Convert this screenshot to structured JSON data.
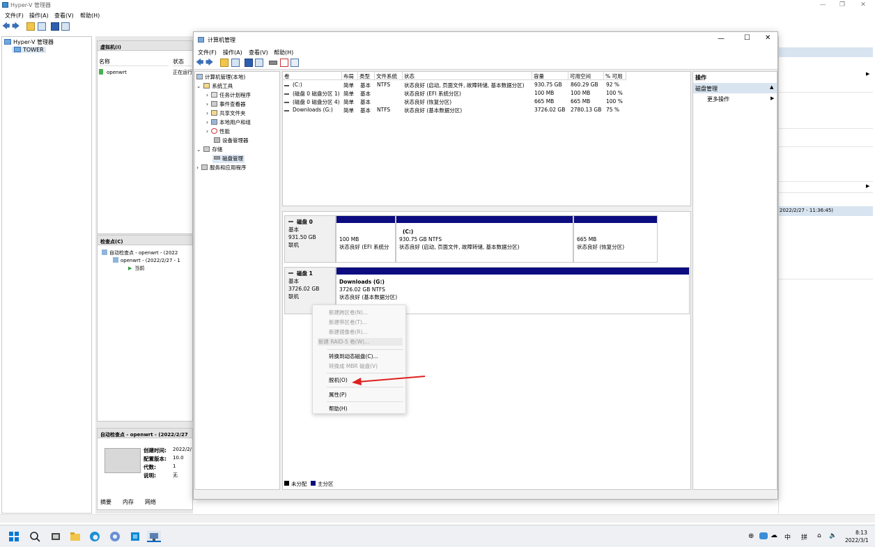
{
  "hyperv": {
    "title": "Hyper-V 管理器",
    "menu": [
      "文件(F)",
      "操作(A)",
      "查看(V)",
      "帮助(H)"
    ],
    "tree_root": "Hyper-V 管理器",
    "tree_host": "TOWER",
    "vm_pane_title": "虚拟机(I)",
    "vm_col_name": "名称",
    "vm_col_state": "状态",
    "vm_name": "openwrt",
    "vm_state": "正在运行",
    "checkpoints_title": "检查点(C)",
    "checkpoint_1": "自动检查点 - openwrt - (2022",
    "checkpoint_2": "openwrt - (2022/2/27 - 1",
    "checkpoint_now": "当前",
    "detail_title": "自动检查点 - openwrt - (2022/2/27",
    "detail_created_label": "创建时间:",
    "detail_created_value": "2022/2/",
    "detail_config_label": "配置版本:",
    "detail_config_value": "10.0",
    "detail_gen_label": "代数:",
    "detail_gen_value": "1",
    "detail_note_label": "说明:",
    "detail_note_value": "无",
    "tabs": [
      "摘要",
      "内存",
      "网络"
    ],
    "right_checkpoint": "2022/2/27 - 11:36:45)"
  },
  "cm": {
    "title": "计算机管理",
    "menu": [
      "文件(F)",
      "操作(A)",
      "查看(V)",
      "帮助(H)"
    ],
    "tree": {
      "root": "计算机管理(本地)",
      "system_tools": "系统工具",
      "task_scheduler": "任务计划程序",
      "event_viewer": "事件查看器",
      "shared_folders": "共享文件夹",
      "local_users": "本地用户和组",
      "performance": "性能",
      "device_manager": "设备管理器",
      "storage": "存储",
      "disk_management": "磁盘管理",
      "services": "服务和应用程序"
    },
    "columns": [
      "卷",
      "布局",
      "类型",
      "文件系统",
      "状态",
      "容量",
      "可用空间",
      "% 可用"
    ],
    "volumes": [
      {
        "name": "(C:)",
        "layout": "简单",
        "type": "基本",
        "fs": "NTFS",
        "status": "状态良好 (启动, 页面文件, 故障转储, 基本数据分区)",
        "capacity": "930.75 GB",
        "free": "860.29 GB",
        "pct": "92 %"
      },
      {
        "name": "(磁盘 0 磁盘分区 1)",
        "layout": "简单",
        "type": "基本",
        "fs": "",
        "status": "状态良好 (EFI 系统分区)",
        "capacity": "100 MB",
        "free": "100 MB",
        "pct": "100 %"
      },
      {
        "name": "(磁盘 0 磁盘分区 4)",
        "layout": "简单",
        "type": "基本",
        "fs": "",
        "status": "状态良好 (恢复分区)",
        "capacity": "665 MB",
        "free": "665 MB",
        "pct": "100 %"
      },
      {
        "name": "Downloads (G:)",
        "layout": "简单",
        "type": "基本",
        "fs": "NTFS",
        "status": "状态良好 (基本数据分区)",
        "capacity": "3726.02 GB",
        "free": "2780.13 GB",
        "pct": "75 %"
      }
    ],
    "disk0": {
      "name": "磁盘 0",
      "type": "基本",
      "size": "931.50 GB",
      "state": "联机"
    },
    "disk0_parts": [
      {
        "title": "",
        "size": "100 MB",
        "status": "状态良好 (EFI 系统分"
      },
      {
        "title": "(C:)",
        "size": "930.75 GB NTFS",
        "status": "状态良好 (启动, 页面文件, 故障转储, 基本数据分区)"
      },
      {
        "title": "",
        "size": "665 MB",
        "status": "状态良好 (恢复分区)"
      }
    ],
    "disk1": {
      "name": "磁盘 1",
      "type": "基本",
      "size": "3726.02 GB",
      "state": "联机"
    },
    "disk1_part": {
      "title": "Downloads  (G:)",
      "size": "3726.02 GB NTFS",
      "status": "状态良好 (基本数据分区)"
    },
    "legend_unalloc": "未分配",
    "legend_primary": "主分区",
    "actions_title": "操作",
    "actions_section": "磁盘管理",
    "actions_more": "更多操作"
  },
  "context_menu": {
    "items": [
      "新建跨区卷(N)...",
      "新建带区卷(T)...",
      "新建镜像卷(R)...",
      "新建 RAID-5 卷(W)...",
      "转换到动态磁盘(C)...",
      "转换成 MBR 磁盘(V)",
      "脱机(O)",
      "属性(P)",
      "帮助(H)"
    ]
  },
  "taskbar": {
    "ime1": "中",
    "ime2": "拼",
    "time": "8:13",
    "date": "2022/3/1"
  },
  "colors": {
    "partition_bar": "#0c0c80",
    "arrow": "#e02020",
    "accent": "#0067c0"
  }
}
